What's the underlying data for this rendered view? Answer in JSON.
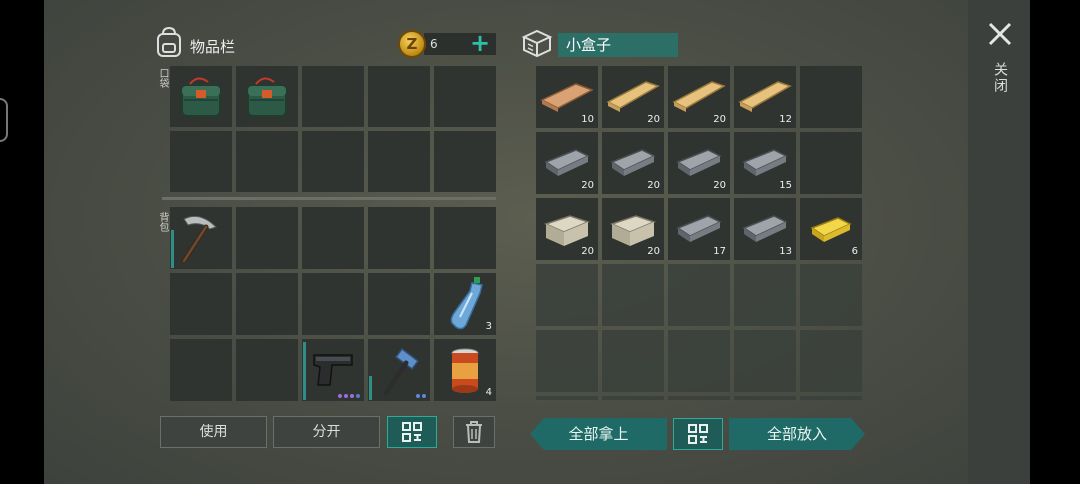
{
  "inventory": {
    "title": "物品栏",
    "coins": "6",
    "pocket_label": "口袋",
    "backpack_label": "背包",
    "pocket_items": [
      {
        "name": "first-aid-bag",
        "qty": ""
      },
      {
        "name": "first-aid-bag",
        "qty": ""
      }
    ],
    "backpack_items": {
      "pickaxe": {
        "qty": ""
      },
      "water_bottle": {
        "qty": "3"
      },
      "pistol": {
        "qty": ""
      },
      "sledgehammer": {
        "qty": ""
      },
      "canned_food": {
        "qty": "4"
      }
    }
  },
  "buttons": {
    "use": "使用",
    "split": "分开",
    "take_all": "全部拿上",
    "put_all": "全部放入"
  },
  "container": {
    "title": "小盒子",
    "rows": [
      [
        {
          "item": "plank-light",
          "qty": "10"
        },
        {
          "item": "plank",
          "qty": "20"
        },
        {
          "item": "plank",
          "qty": "20"
        },
        {
          "item": "plank",
          "qty": "12"
        },
        {
          "item": "",
          "qty": ""
        }
      ],
      [
        {
          "item": "iron-ingot",
          "qty": "20"
        },
        {
          "item": "iron-ingot",
          "qty": "20"
        },
        {
          "item": "iron-ingot",
          "qty": "20"
        },
        {
          "item": "iron-ingot",
          "qty": "15"
        },
        {
          "item": "",
          "qty": ""
        }
      ],
      [
        {
          "item": "stone",
          "qty": "20"
        },
        {
          "item": "stone",
          "qty": "20"
        },
        {
          "item": "iron-ingot",
          "qty": "17"
        },
        {
          "item": "iron-ingot",
          "qty": "13"
        },
        {
          "item": "gold-ingot",
          "qty": "6"
        }
      ]
    ]
  },
  "header": {
    "close_label": "关闭"
  },
  "colors": {
    "accent_teal": "#2fbfa6",
    "button_teal": "#1f6a66",
    "slot_bg": "#2f3431"
  }
}
